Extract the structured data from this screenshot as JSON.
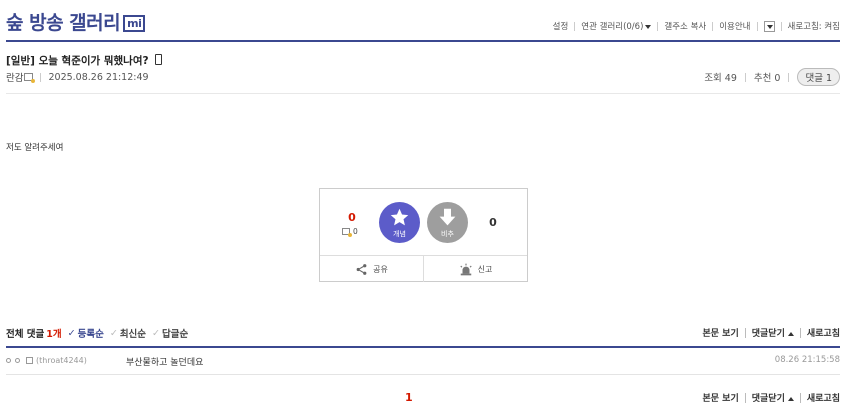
{
  "gallery": {
    "title": "숲 방송 갤러리",
    "badge": "mi",
    "accent_color": "#3b4890"
  },
  "header_links": {
    "settings": "설정",
    "related": "연관 갤러리(0/6)",
    "copy_address": "갤주소 복사",
    "guide": "이용안내",
    "refresh": "새로고침: 켜짐"
  },
  "post": {
    "title": "[일반] 오늘 혁준이가 뭐했나여?",
    "author": "란감",
    "date": "2025.08.26 21:12:49",
    "views": "조회 49",
    "recommends": "추천 0",
    "comments_pill": "댓글 1",
    "body": "저도 알려주세여"
  },
  "recommend": {
    "up_count": "0",
    "fixed_count": "0",
    "up_label": "개념",
    "down_label": "비추",
    "down_count": "0",
    "share_label": "공유",
    "report_label": "신고"
  },
  "comments": {
    "total_label": "전체 댓글",
    "total_count": "1개",
    "sort_registered": "등록순",
    "sort_latest": "최신순",
    "sort_reply": "답글순",
    "view_post": "본문 보기",
    "close_comments": "댓글닫기",
    "refresh": "새로고침",
    "items": [
      {
        "nick": "(throat4244)",
        "text": "부산물하고 놀던데요",
        "date": "08.26 21:15:58"
      }
    ]
  },
  "pagination": {
    "current": "1"
  }
}
